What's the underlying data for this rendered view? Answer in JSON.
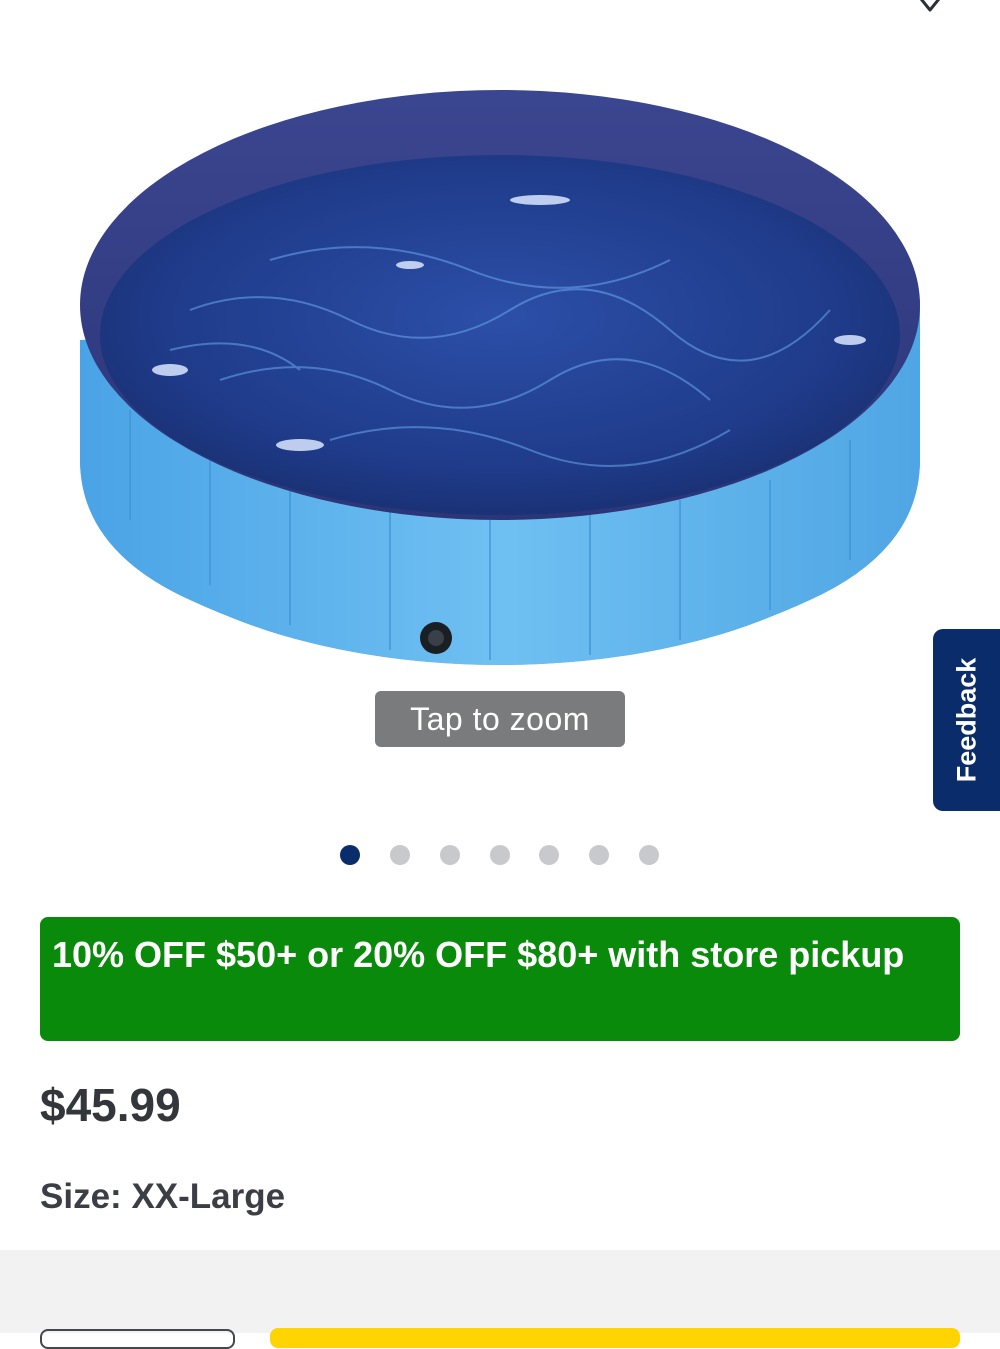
{
  "image_overlay": {
    "zoom_label": "Tap to zoom"
  },
  "feedback_tab": {
    "label": "Feedback"
  },
  "carousel": {
    "total": 7,
    "active_index": 0
  },
  "promo": {
    "text": "10% OFF $50+ or 20% OFF $80+ with store pickup",
    "color": "#0a8a0a"
  },
  "product": {
    "price": "$45.99",
    "size_label": "Size:",
    "size_value": "XX-Large"
  },
  "colors": {
    "brand_navy": "#0b2c6b",
    "cta_yellow": "#ffd400"
  },
  "icons": {
    "favorite": "heart-outline-icon"
  }
}
